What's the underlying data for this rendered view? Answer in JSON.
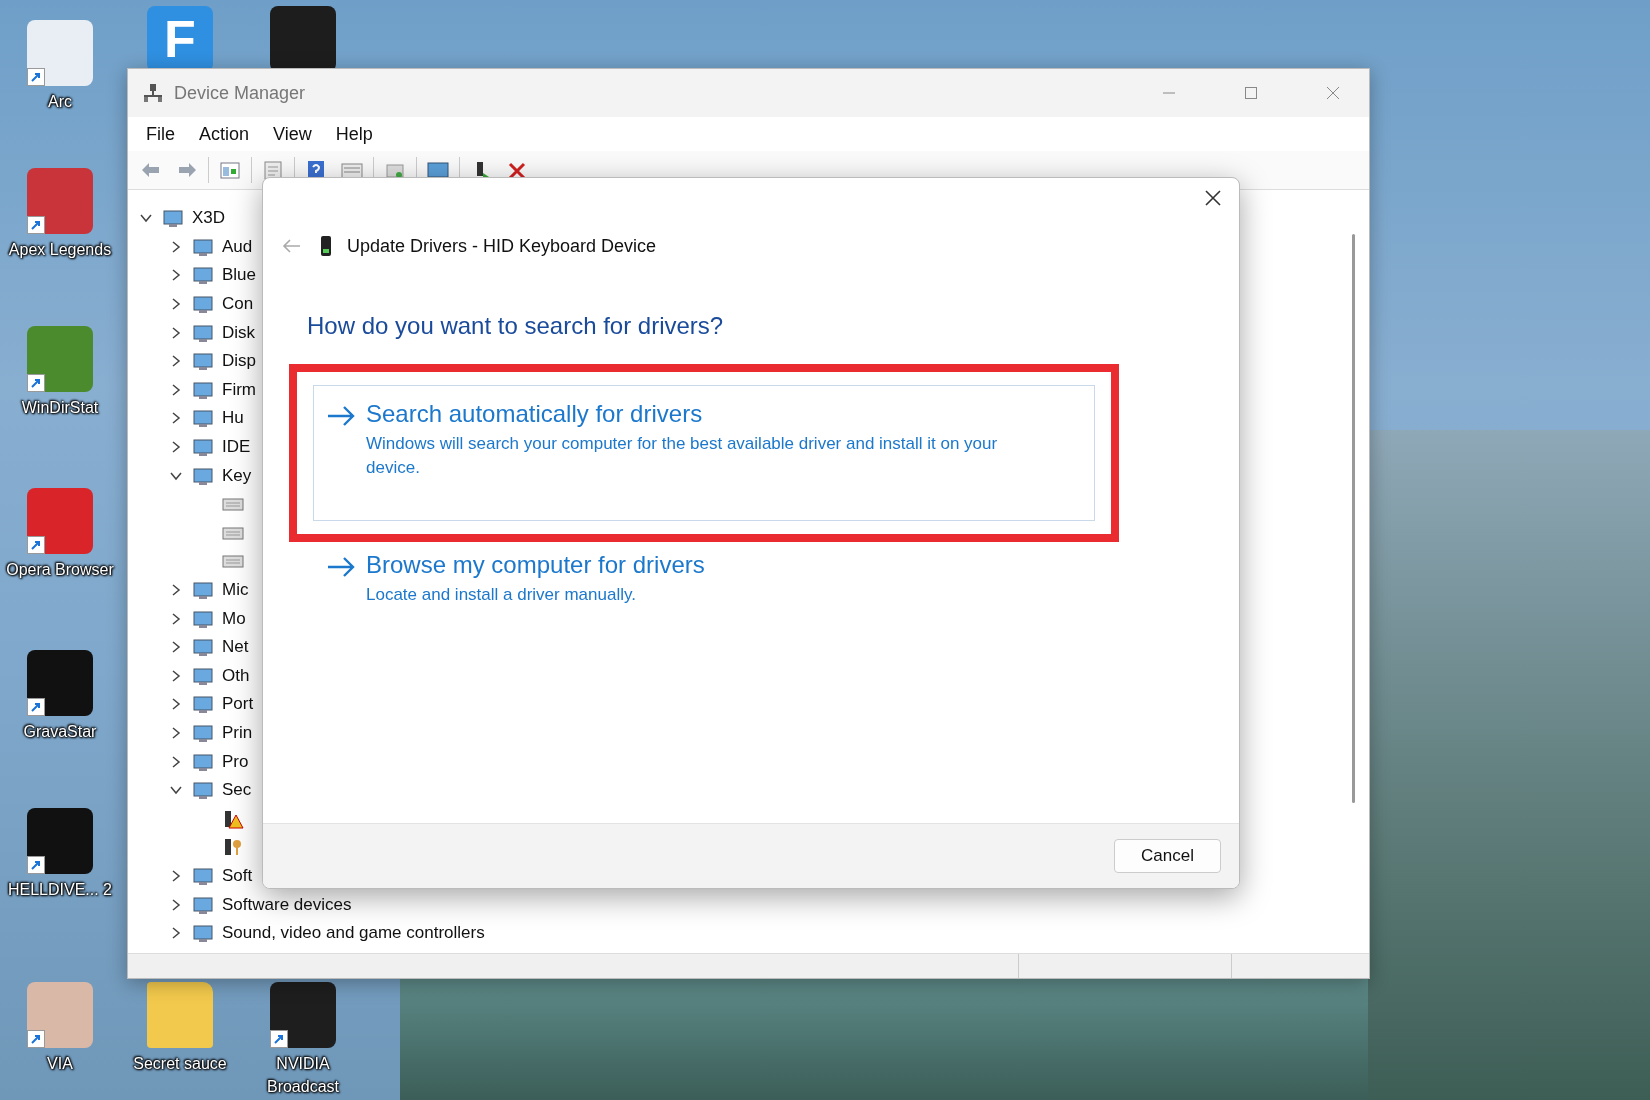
{
  "desktop": {
    "icons": [
      {
        "label": "Arc",
        "kind": "app",
        "shortcut": true
      },
      {
        "label": "Apex Legends",
        "kind": "app",
        "shortcut": true
      },
      {
        "label": "WinDirStat",
        "kind": "app",
        "shortcut": true
      },
      {
        "label": "Opera Browser",
        "kind": "app",
        "shortcut": true
      },
      {
        "label": "GravaStar",
        "kind": "app",
        "shortcut": true
      },
      {
        "label": "HELLDIVE... 2",
        "kind": "app",
        "shortcut": true
      },
      {
        "label": "VIA",
        "kind": "app",
        "shortcut": true
      },
      {
        "logo_text": "F",
        "kind": "app",
        "shortcut": false
      },
      {
        "kind": "app",
        "shortcut": false
      },
      {
        "label": "Secret sauce",
        "kind": "folder",
        "shortcut": false
      },
      {
        "label": "NVIDIA Broadcast",
        "kind": "app",
        "shortcut": true
      }
    ]
  },
  "window": {
    "title": "Device Manager",
    "menu": [
      "File",
      "Action",
      "View",
      "Help"
    ],
    "tree": {
      "label": "X3D",
      "expanded": true,
      "children": [
        {
          "label": "Aud",
          "expanded": false
        },
        {
          "label": "Blue",
          "expanded": false
        },
        {
          "label": "Con",
          "expanded": false
        },
        {
          "label": "Disk",
          "expanded": false
        },
        {
          "label": "Disp",
          "expanded": false
        },
        {
          "label": "Firm",
          "expanded": false
        },
        {
          "label": "Hu",
          "expanded": false
        },
        {
          "label": "IDE",
          "expanded": false
        },
        {
          "label": "Key",
          "expanded": true,
          "children": [
            {
              "kind": "keyboard"
            },
            {
              "kind": "keyboard"
            },
            {
              "kind": "keyboard"
            }
          ]
        },
        {
          "label": "Mic",
          "expanded": false
        },
        {
          "label": "Mo",
          "expanded": false
        },
        {
          "label": "Net",
          "expanded": false
        },
        {
          "label": "Oth",
          "expanded": false
        },
        {
          "label": "Port",
          "expanded": false
        },
        {
          "label": "Prin",
          "expanded": false
        },
        {
          "label": "Pro",
          "expanded": false
        },
        {
          "label": "Sec",
          "expanded": true,
          "children": [
            {
              "kind": "warning"
            },
            {
              "kind": "key"
            }
          ]
        },
        {
          "label": "Soft",
          "expanded": false
        },
        {
          "label": "Software devices",
          "expanded": false
        },
        {
          "label": "Sound, video and game controllers",
          "expanded": false
        }
      ]
    }
  },
  "dialog": {
    "title": "Update Drivers - HID Keyboard Device",
    "question": "How do you want to search for drivers?",
    "options": [
      {
        "title": "Search automatically for drivers",
        "description": "Windows will search your computer for the best available driver and install it on your device.",
        "highlighted": true
      },
      {
        "title": "Browse my computer for drivers",
        "description": "Locate and install a driver manually.",
        "highlighted": false
      }
    ],
    "buttons": [
      "Cancel"
    ]
  }
}
